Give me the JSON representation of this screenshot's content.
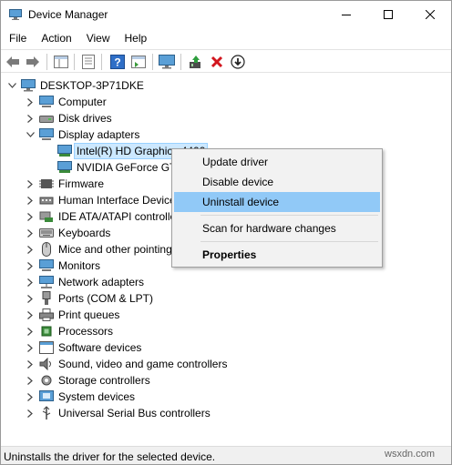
{
  "window": {
    "title": "Device Manager"
  },
  "menu": [
    "File",
    "Action",
    "View",
    "Help"
  ],
  "toolbar": {
    "buttons": [
      "back-icon",
      "forward-icon",
      "show-hide-tree-icon",
      "properties-icon",
      "help-icon",
      "action-pane-icon",
      "monitor-icon",
      "update-driver-icon",
      "uninstall-icon",
      "enable-device-icon"
    ]
  },
  "tree": {
    "root": "DESKTOP-3P71DKE",
    "items": [
      {
        "label": "Computer",
        "icon": "computer-icon"
      },
      {
        "label": "Disk drives",
        "icon": "disk-drive-icon"
      },
      {
        "label": "Display adapters",
        "icon": "display-adapter-icon",
        "expanded": true
      },
      {
        "label": "Intel(R) HD Graphics 4400",
        "icon": "display-card-icon",
        "child": true,
        "selected": true
      },
      {
        "label": "NVIDIA GeForce GT...",
        "icon": "display-card-icon",
        "child": true
      },
      {
        "label": "Firmware",
        "icon": "firmware-icon"
      },
      {
        "label": "Human Interface Devices",
        "icon": "hid-icon"
      },
      {
        "label": "IDE ATA/ATAPI controllers",
        "icon": "ide-icon"
      },
      {
        "label": "Keyboards",
        "icon": "keyboard-icon"
      },
      {
        "label": "Mice and other pointing devices",
        "icon": "mouse-icon"
      },
      {
        "label": "Monitors",
        "icon": "monitor-icon"
      },
      {
        "label": "Network adapters",
        "icon": "network-icon"
      },
      {
        "label": "Ports (COM & LPT)",
        "icon": "port-icon"
      },
      {
        "label": "Print queues",
        "icon": "printer-icon"
      },
      {
        "label": "Processors",
        "icon": "processor-icon"
      },
      {
        "label": "Software devices",
        "icon": "software-icon"
      },
      {
        "label": "Sound, video and game controllers",
        "icon": "sound-icon"
      },
      {
        "label": "Storage controllers",
        "icon": "storage-icon"
      },
      {
        "label": "System devices",
        "icon": "system-icon"
      },
      {
        "label": "Universal Serial Bus controllers",
        "icon": "usb-icon"
      }
    ]
  },
  "context_menu": {
    "update": "Update driver",
    "disable": "Disable device",
    "uninstall": "Uninstall device",
    "scan": "Scan for hardware changes",
    "properties": "Properties"
  },
  "status": "Uninstalls the driver for the selected device.",
  "watermark": "wsxdn.com",
  "colors": {
    "selection": "#cce8ff",
    "menu_highlight": "#91c9f7",
    "accent": "#0078d7"
  }
}
